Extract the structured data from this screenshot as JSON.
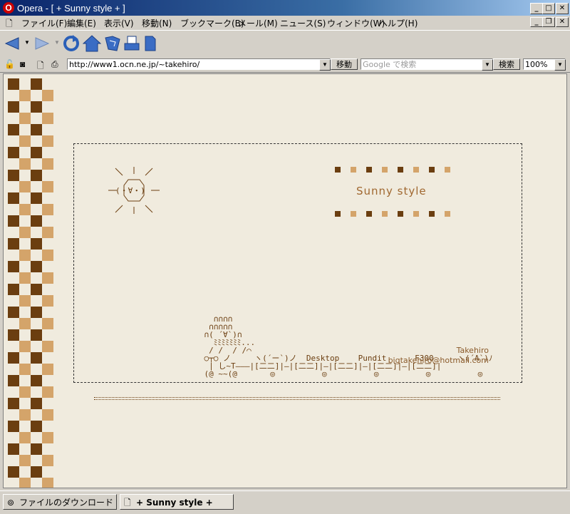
{
  "window": {
    "title": "Opera - [ + Sunny style + ]",
    "logo": "O",
    "controls": [
      "_",
      "□",
      "✕"
    ]
  },
  "menu": {
    "items": [
      "ファイル(F)",
      "編集(E)",
      "表示(V)",
      "移動(N)",
      "ブックマーク(B)",
      "メール(M)",
      "ニュース(S)",
      "ウィンドウ(W)",
      "ヘルプ(H)"
    ]
  },
  "toolbar": {
    "icons": [
      "back-icon",
      "forward-icon",
      "reload-icon",
      "home-icon",
      "hotlist-icon",
      "print-icon",
      "page-icon"
    ]
  },
  "addressbar": {
    "url": "http://www1.ocn.ne.jp/~takehiro/",
    "go_label": "移動",
    "search_placeholder": "Google で検索",
    "search_label": "検索",
    "zoom": "100%"
  },
  "page": {
    "sun_face": "(・∀・)",
    "site_title": "Sunny style",
    "train_art": "      ∩∩∩∩\n     ∩∩∩∩∩\n    ∩( ´∀`)∩\n      ﾐﾐﾐﾐﾐﾐﾐ...\n     / /  / /⌒\n    ○┬○ ノ     ヽ(´ー`)ノ  Desktop    Pundit      F300     ヽ(´A`)ﾉ\n     | し~T―――|[二二]|―|[二二]|―|[二二]|―|[二二]|―|[二二]|\n    (@ ~~(@       ◎          ◎          ◎          ◎          ◎",
    "author": "Takehiro",
    "email": "bigtakehiro@hotmail.com"
  },
  "status": {
    "tabs": [
      "ファイルのダウンロード",
      "+ Sunny style +"
    ]
  },
  "colors": {
    "background": "#f0ebde",
    "dark_brown": "#6b3e10",
    "tan": "#d4a46a",
    "text_brown": "#8a5a2a"
  }
}
